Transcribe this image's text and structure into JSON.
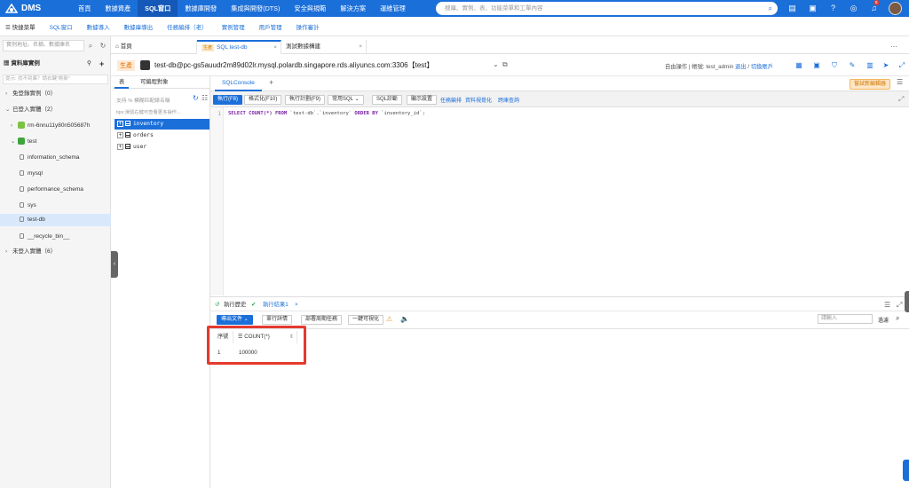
{
  "topnav": {
    "logo": "DMS",
    "items": [
      "首頁",
      "數據資產",
      "SQL窗口",
      "數據庫開發",
      "集成與開發(DTS)",
      "安全與規範",
      "解決方案",
      "運維管理"
    ],
    "active_index": 2,
    "search_placeholder": "搜庫、實例、表、功能菜單和工單內容",
    "notification_badge": "8"
  },
  "subnav": {
    "quick_menu": "快捷菜單",
    "items": [
      "SQL窗口",
      "數據導入",
      "數據庫導出",
      "任務編排（老）",
      "實例管理",
      "用戶管理",
      "操作審計"
    ]
  },
  "sidebar": {
    "search_placeholder": "實例地址、名稱、數據庫名",
    "header": "資料庫實例",
    "tip": "提示: 找不到庫？請右鍵\"刷新\"",
    "tree": [
      {
        "label": "免登錄實例（0）",
        "caret": "›",
        "indent": 0
      },
      {
        "label": "已登入實體（2）",
        "caret": "⌄",
        "indent": 0
      },
      {
        "label": "rm-6nnu11y80n505687h",
        "caret": "›",
        "indent": 1,
        "icon": "rds"
      },
      {
        "label": "test",
        "caret": "⌄",
        "indent": 1,
        "icon": "polardb"
      },
      {
        "label": "information_schema",
        "indent": 2
      },
      {
        "label": "mysql",
        "indent": 2
      },
      {
        "label": "performance_schema",
        "indent": 2
      },
      {
        "label": "sys",
        "indent": 2
      },
      {
        "label": "test-db",
        "indent": 2,
        "selected": true
      },
      {
        "label": "__recycle_bin__",
        "indent": 2
      },
      {
        "label": "未登入實體（6）",
        "caret": "›",
        "indent": 0
      }
    ]
  },
  "tabs": {
    "home": "首頁",
    "prod_badge": "生產",
    "sql_tab": "SQL test-db",
    "data_tab": "測試數據構建"
  },
  "instance": {
    "env": "生產",
    "name": "test-db@pc-gs5auudr2m89d02lr.mysql.polardb.singapore.rds.aliyuncs.com:3306【test】",
    "mode": "自由操作",
    "account_label": "帳號: test_admin",
    "logout": "退出",
    "switch": "切換賬戶"
  },
  "objects": {
    "tab_tables": "表",
    "tab_programmable": "可編程對象",
    "search_placeholder": "支持 % 模糊匹配錶名稱",
    "tip": "tips:滑鼠右鍵可查看更多操作...",
    "tables": [
      "inventory",
      "orders",
      "user"
    ],
    "selected_index": 0
  },
  "console": {
    "tab": "SQLConsole",
    "try_new": "嘗試新編輯器"
  },
  "toolbar": {
    "execute": "執行(F8)",
    "format": "格式化(F10)",
    "plan": "執行計劃(F9)",
    "common_sql": "常用SQL",
    "diagnose": "SQL診斷",
    "display_settings": "顯示設置",
    "task_orchestration": "任務編排",
    "visualization": "資料視覺化",
    "cross_db": "跨庫查詢"
  },
  "editor": {
    "line_numbers": [
      "1"
    ],
    "sql": {
      "kw1": "SELECT COUNT(*) FROM",
      "tbl": " `test-db`.`inventory` ",
      "kw2": "ORDER BY",
      "col": " `inventory_id`",
      "end": ";"
    }
  },
  "results": {
    "history": "執行歷史",
    "result_tab": "執行結果1",
    "export": "導出文件",
    "row_detail": "單行詳情",
    "deploy": "部署周期任務",
    "one_click": "一鍵可視化",
    "filter_placeholder": "請輸入",
    "filter_label": "過濾",
    "columns": [
      "序號",
      "COUNT(*)"
    ],
    "rows": [
      [
        "1",
        "100000"
      ]
    ]
  }
}
